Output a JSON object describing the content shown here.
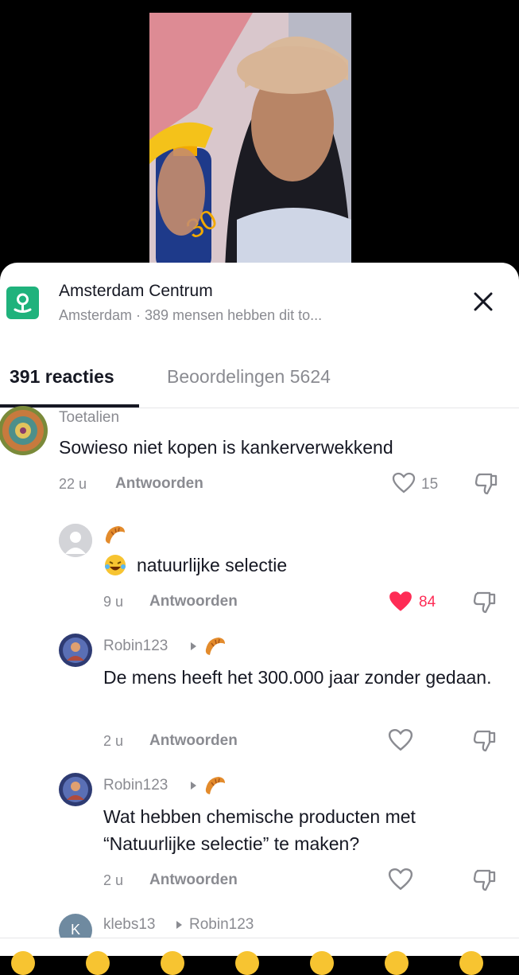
{
  "location": {
    "title": "Amsterdam Centrum",
    "subtitle": "Amsterdam · 389 mensen hebben dit to..."
  },
  "tabs": [
    {
      "label": "391 reacties",
      "active": true
    },
    {
      "label": "Beoordelingen 5624",
      "active": false
    }
  ],
  "comments": [
    {
      "username": "Toetalien",
      "text": "Sowieso niet kopen is kankerverwekkend",
      "time": "22 u",
      "reply": "Antwoorden",
      "likes": "15",
      "liked": false
    },
    {
      "username": "",
      "emoji_badge": "croissant-icon",
      "text": "natuurlijke selectie",
      "text_emoji": "laughing-emoji-icon",
      "time": "9 u",
      "reply": "Antwoorden",
      "likes": "84",
      "liked": true
    },
    {
      "username": "Robin123",
      "emoji_badge": "croissant-icon",
      "text": "De mens heeft het 300.000 jaar zonder gedaan.",
      "time": "2 u",
      "reply": "Antwoorden",
      "likes": "",
      "liked": false
    },
    {
      "username": "Robin123",
      "emoji_badge": "croissant-icon",
      "text": "Wat hebben chemische producten met “Natuurlijke selectie” te maken?",
      "time": "2 u",
      "reply": "Antwoorden",
      "likes": "",
      "liked": false
    },
    {
      "username": "klebs13",
      "reply_to": "Robin123",
      "avatar_letter": "K"
    }
  ],
  "colors": {
    "accent_like": "#fe2c55",
    "pin_green": "#1fb27c",
    "muted": "#8a8b91",
    "text": "#161823"
  }
}
